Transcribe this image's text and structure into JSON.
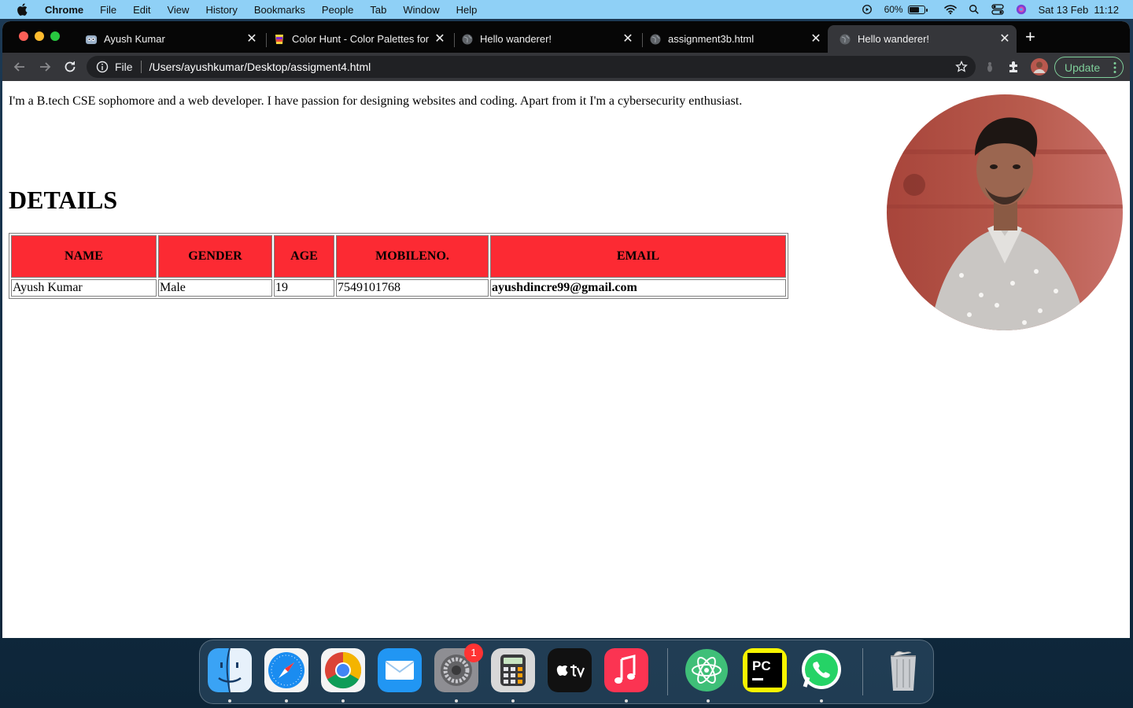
{
  "menubar": {
    "app": "Chrome",
    "items": [
      "File",
      "Edit",
      "View",
      "History",
      "Bookmarks",
      "People",
      "Tab",
      "Window",
      "Help"
    ],
    "battery_percent": "60%",
    "datetime": "Sat 13 Feb  11:12"
  },
  "tabs": [
    {
      "title": "Ayush Kumar",
      "icon": "mascot-icon",
      "active": false
    },
    {
      "title": "Color Hunt - Color Palettes for",
      "icon": "colorhunt-icon",
      "active": false
    },
    {
      "title": "Hello wanderer!",
      "icon": "globe-icon",
      "active": false
    },
    {
      "title": "assignment3b.html",
      "icon": "globe-icon",
      "active": false
    },
    {
      "title": "Hello wanderer!",
      "icon": "globe-icon",
      "active": true
    }
  ],
  "omnibox": {
    "scheme": "File",
    "url": "/Users/ayushkumar/Desktop/assigment4.html"
  },
  "update_label": "Update",
  "page": {
    "intro": "I'm a B.tech CSE sophomore and a web developer. I have passion for designing websites and coding. Apart from it I'm a cybersecurity enthusiast.",
    "heading": "DETAILS",
    "table": {
      "headers": [
        "NAME",
        "GENDER",
        "AGE",
        "MOBILENO.",
        "EMAIL"
      ],
      "rows": [
        [
          "Ayush Kumar",
          "Male",
          "19",
          "7549101768",
          "ayushdincre99@gmail.com"
        ]
      ]
    }
  },
  "dock": {
    "apps": [
      "Finder",
      "Safari",
      "Chrome",
      "Mail",
      "System Preferences",
      "Calculator",
      "Apple TV",
      "Music",
      "Atom",
      "PyCharm",
      "WhatsApp",
      "Trash"
    ],
    "settings_badge": "1"
  },
  "colors": {
    "table_header_bg": "#fc2a33",
    "menubar_bg": "#8fd0f6",
    "update_green": "#7fcf9a"
  }
}
